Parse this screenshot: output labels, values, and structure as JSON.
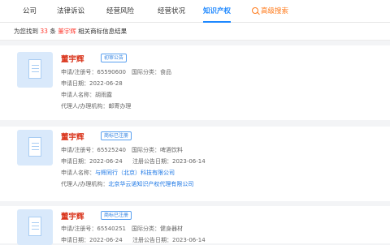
{
  "nav": {
    "tabs": [
      {
        "label": "公司"
      },
      {
        "label": "法律诉讼"
      },
      {
        "label": "经营风险"
      },
      {
        "label": "经营状况"
      },
      {
        "label": "知识产权"
      },
      {
        "label": "高级搜索"
      }
    ],
    "active_tab": "知识产权"
  },
  "summary": {
    "prefix": "为您找到",
    "count": "33",
    "unit": "条",
    "keyword": "董宇辉",
    "suffix": "相关商标信息结果"
  },
  "colors": {
    "accent": "#1e88ff",
    "keyword_red": "#d9331a",
    "advanced_orange": "#ff7a1a"
  },
  "results": [
    {
      "title": "董宇辉",
      "status": "初审公告",
      "reg_no_label": "申请/注册号：",
      "reg_no": "65590600",
      "class_label": "国际分类：",
      "class_value": "食品",
      "date_label": "申请日期：",
      "date": "2022-06-28",
      "applicant_label": "申请人名称：",
      "applicant": "胡雨露",
      "agent_label": "代理人/办理机构：",
      "agent": "邮寄办理"
    },
    {
      "title": "董宇辉",
      "status": "商标已注册",
      "reg_no_label": "申请/注册号：",
      "reg_no": "65525240",
      "class_label": "国际分类：",
      "class_value": "啤酒饮料",
      "date_label": "申请日期：",
      "date": "2022-06-24",
      "pub_label": "注册公告日期：",
      "pub_date": "2023-06-14",
      "applicant_label": "申请人名称：",
      "applicant": "与辉同行（北京）科技有限公司",
      "agent_label": "代理人/办理机构：",
      "agent": "北京华云诺知识产权代理有限公司"
    },
    {
      "title": "董宇辉",
      "status": "商标已注册",
      "reg_no_label": "申请/注册号：",
      "reg_no": "65540251",
      "class_label": "国际分类：",
      "class_value": "健身器材",
      "date_label": "申请日期：",
      "date": "2022-06-24",
      "pub_label": "注册公告日期：",
      "pub_date": "2023-06-14"
    }
  ]
}
